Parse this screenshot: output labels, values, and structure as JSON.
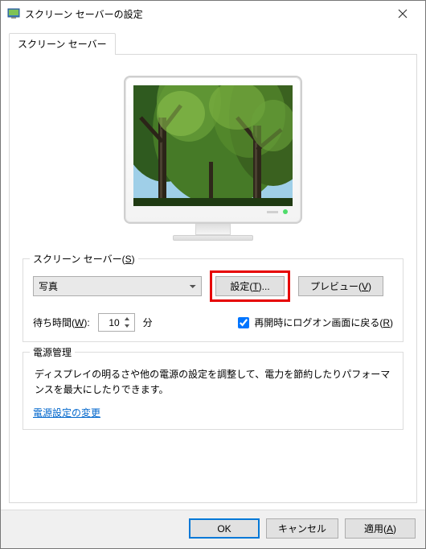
{
  "window": {
    "title": "スクリーン セーバーの設定"
  },
  "tab": {
    "label": "スクリーン セーバー"
  },
  "group_ss": {
    "legend_pre": "スクリーン セーバー(",
    "legend_key": "S",
    "legend_post": ")",
    "combo_value": "写真",
    "settings_btn_pre": "設定(",
    "settings_btn_key": "T",
    "settings_btn_post": ")...",
    "preview_btn_pre": "プレビュー(",
    "preview_btn_key": "V",
    "preview_btn_post": ")",
    "wait_label_pre": "待ち時間(",
    "wait_label_key": "W",
    "wait_label_post": "):",
    "wait_value": "10",
    "wait_unit": "分",
    "resume_label_pre": "再開時にログオン画面に戻る(",
    "resume_label_key": "R",
    "resume_label_post": ")",
    "resume_checked": true
  },
  "group_pm": {
    "legend": "電源管理",
    "text": "ディスプレイの明るさや他の電源の設定を調整して、電力を節約したりパフォーマンスを最大にしたりできます。",
    "link": "電源設定の変更"
  },
  "buttons": {
    "ok": "OK",
    "cancel": "キャンセル",
    "apply_pre": "適用(",
    "apply_key": "A",
    "apply_post": ")"
  }
}
